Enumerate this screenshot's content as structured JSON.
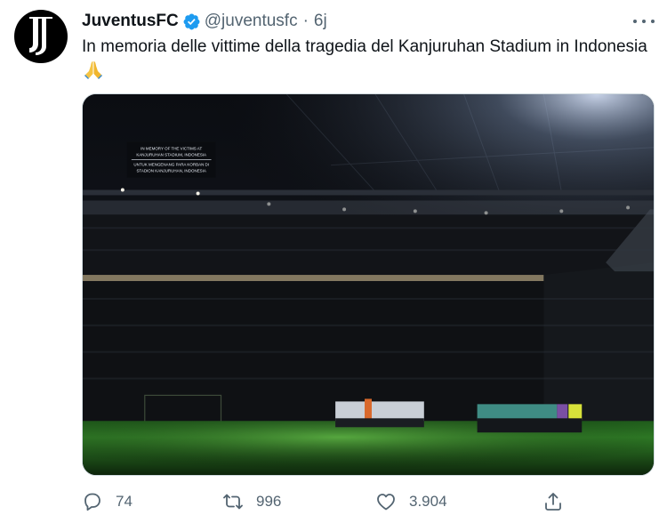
{
  "tweet": {
    "author_name": "JuventusFC",
    "handle": "@juventusfc",
    "separator": "·",
    "time": "6j",
    "text": "In memoria delle vittime della tragedia del Kanjuruhan Stadium in Indonesia",
    "emoji": "folded-hands"
  },
  "image": {
    "board_lines": [
      "IN MEMORY OF THE VICTIMS AT",
      "KANJURUHAN STADIUM, INDONESIA",
      "UNTUK MENGENANG PARA KORBAN DI",
      "STADION KANJURUHAN, INDONESIA"
    ]
  },
  "actions": {
    "replies": "74",
    "retweets": "996",
    "likes": "3.904"
  },
  "colors": {
    "text": "#0f1419",
    "secondary": "#536471",
    "verified": "#1d9bf0",
    "border": "#cfd9de"
  }
}
